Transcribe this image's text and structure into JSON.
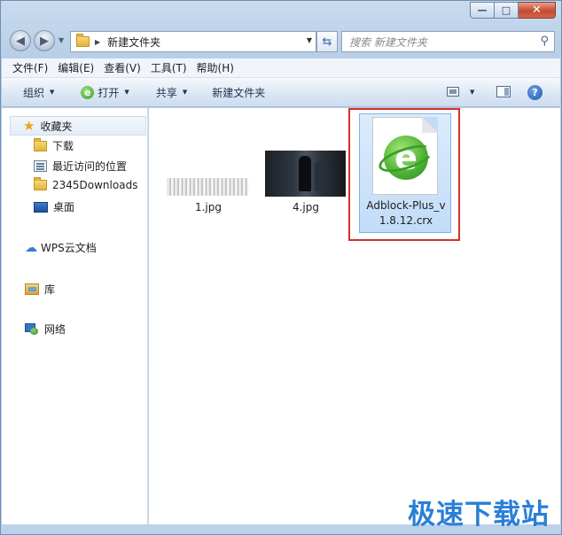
{
  "window": {
    "address_path": "新建文件夹",
    "search_placeholder": "搜索 新建文件夹"
  },
  "menu": [
    "文件(F)",
    "编辑(E)",
    "查看(V)",
    "工具(T)",
    "帮助(H)"
  ],
  "toolbar": {
    "organize": "组织",
    "open": "打开",
    "share": "共享",
    "new_folder": "新建文件夹"
  },
  "sidebar": {
    "favorites": "收藏夹",
    "downloads": "下载",
    "recent": "最近访问的位置",
    "folder_2345": "2345Downloads",
    "desktop": "桌面",
    "wps_cloud": "WPS云文档",
    "libraries": "库",
    "network": "网络"
  },
  "files": [
    {
      "name": "1.jpg"
    },
    {
      "name": "4.jpg"
    },
    {
      "name": "Adblock-Plus_v1.8.12.crx",
      "line1": "Adblock-Plus_v",
      "line2": "1.8.12.crx",
      "selected": true
    }
  ],
  "watermark": "极速下载站",
  "colors": {
    "highlight_border": "#d6302b",
    "selection": "#c2dcf8",
    "watermark": "#2a7fd6"
  }
}
